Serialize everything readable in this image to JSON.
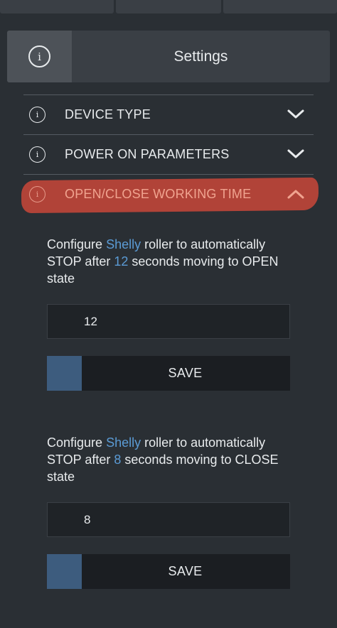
{
  "header": {
    "title": "Settings",
    "icon": "info-icon"
  },
  "accordion": [
    {
      "label": "DEVICE TYPE",
      "icon": "info-icon",
      "expanded": false
    },
    {
      "label": "POWER ON PARAMETERS",
      "icon": "info-icon",
      "expanded": false
    },
    {
      "label": "OPEN/CLOSE WORKING TIME",
      "icon": "info-icon",
      "expanded": true,
      "highlight_color": "#c9473a"
    }
  ],
  "open_section": {
    "desc_prefix": "Configure ",
    "device_name": "Shelly",
    "desc_mid1": " roller to automatically STOP after ",
    "seconds": "12",
    "desc_mid2": " seconds moving to OPEN state",
    "input_value": "12",
    "save_label": "SAVE"
  },
  "close_section": {
    "desc_prefix": "Configure ",
    "device_name": "Shelly",
    "desc_mid1": " roller to automatically STOP after ",
    "seconds": "8",
    "desc_mid2": " seconds moving to CLOSE state",
    "input_value": "8",
    "save_label": "SAVE"
  },
  "colors": {
    "background": "#2a2f34",
    "accent": "#5b9bd5",
    "save_indicator": "#3d5c7e"
  }
}
